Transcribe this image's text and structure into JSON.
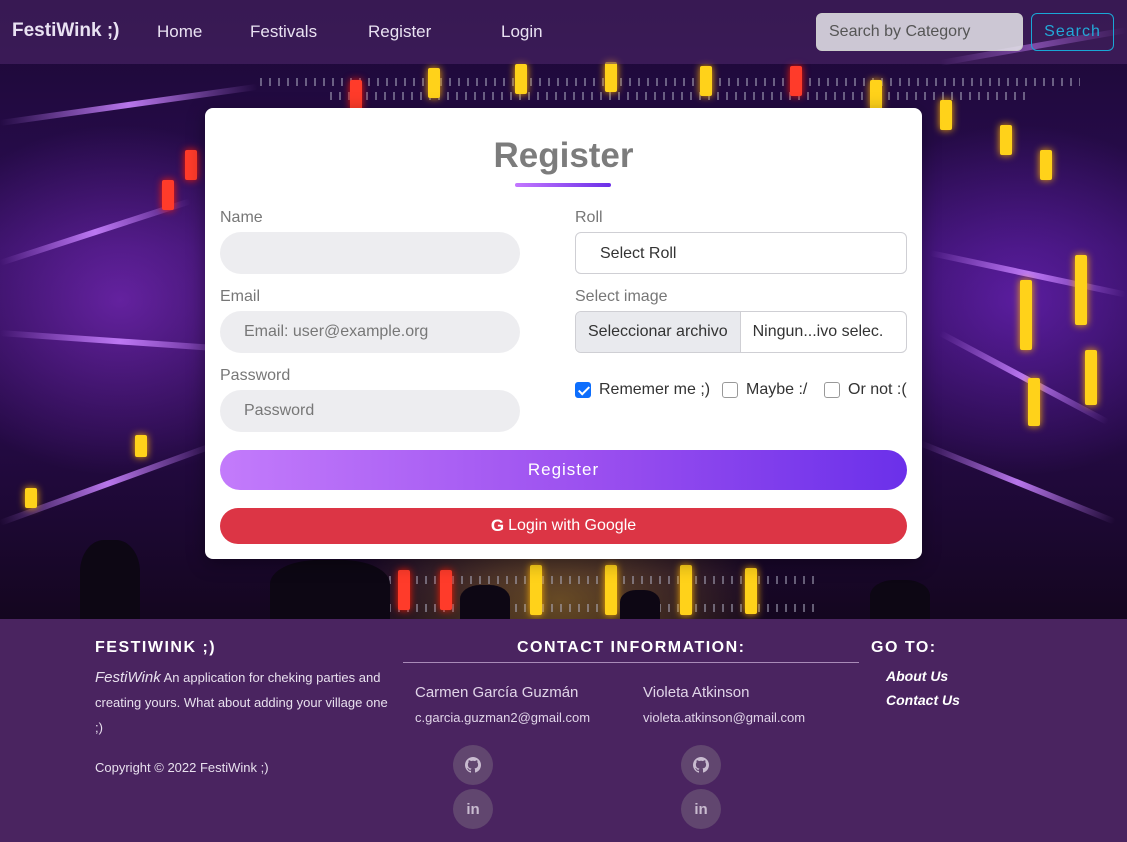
{
  "navbar": {
    "brand": "FestiWink ;)",
    "links": [
      "Home",
      "Festivals",
      "Register",
      "Login"
    ],
    "search_placeholder": "Search by Category",
    "search_button": "Search"
  },
  "form": {
    "title": "Register",
    "name_label": "Name",
    "name_value": "",
    "email_label": "Email",
    "email_placeholder": "Email: user@example.org",
    "password_label": "Password",
    "password_placeholder": "Password",
    "roll_label": "Roll",
    "roll_selected": "Select Roll",
    "image_label": "Select image",
    "file_button": "Seleccionar archivo",
    "file_name": "Ningun...ivo selec.",
    "checkboxes": [
      {
        "label": "Rememer me ;)",
        "checked": true
      },
      {
        "label": "Maybe :/",
        "checked": false
      },
      {
        "label": "Or not :(",
        "checked": false
      }
    ],
    "register_button": "Register",
    "google_button": "Login with Google",
    "google_icon": "google-icon"
  },
  "footer": {
    "brand_heading": "FESTIWINK ;)",
    "brand_name": "FestiWink",
    "description": "An application for cheking parties and creating yours. What about adding your village one ;)",
    "copyright": "Copyright © 2022 FestiWink ;)",
    "contact_heading": "CONTACT INFORMATION:",
    "contacts": [
      {
        "name": "Carmen García Guzmán",
        "email": "c.garcia.guzman2@gmail.com",
        "icons": [
          "github-icon",
          "linkedin-icon"
        ]
      },
      {
        "name": "Violeta Atkinson",
        "email": "violeta.atkinson@gmail.com",
        "icons": [
          "github-icon",
          "linkedin-icon"
        ]
      }
    ],
    "goto_heading": "GO TO:",
    "goto_links": [
      "About Us",
      "Contact Us"
    ]
  },
  "colors": {
    "navbar_bg": "#50286e",
    "footer_bg": "#4a2460",
    "register_gradient_start": "#c37bfb",
    "register_gradient_end": "#6b30ea",
    "google_red": "#dc3545",
    "search_accent": "#23a9d8"
  }
}
